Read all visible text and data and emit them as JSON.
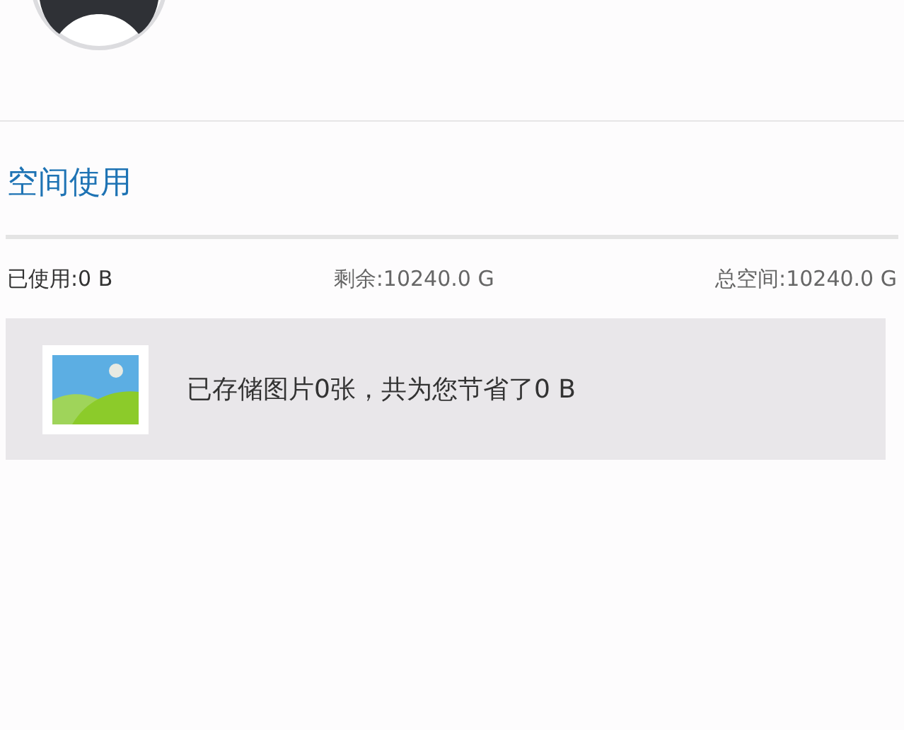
{
  "section_title": "空间使用",
  "stats": [
    {
      "label": "已使用:0 B"
    },
    {
      "label": "剩余:10240.0 G"
    },
    {
      "label": "总空间:10240.0 G"
    }
  ],
  "storage_card": {
    "text": "已存储图片0张，共为您节省了0 B"
  }
}
